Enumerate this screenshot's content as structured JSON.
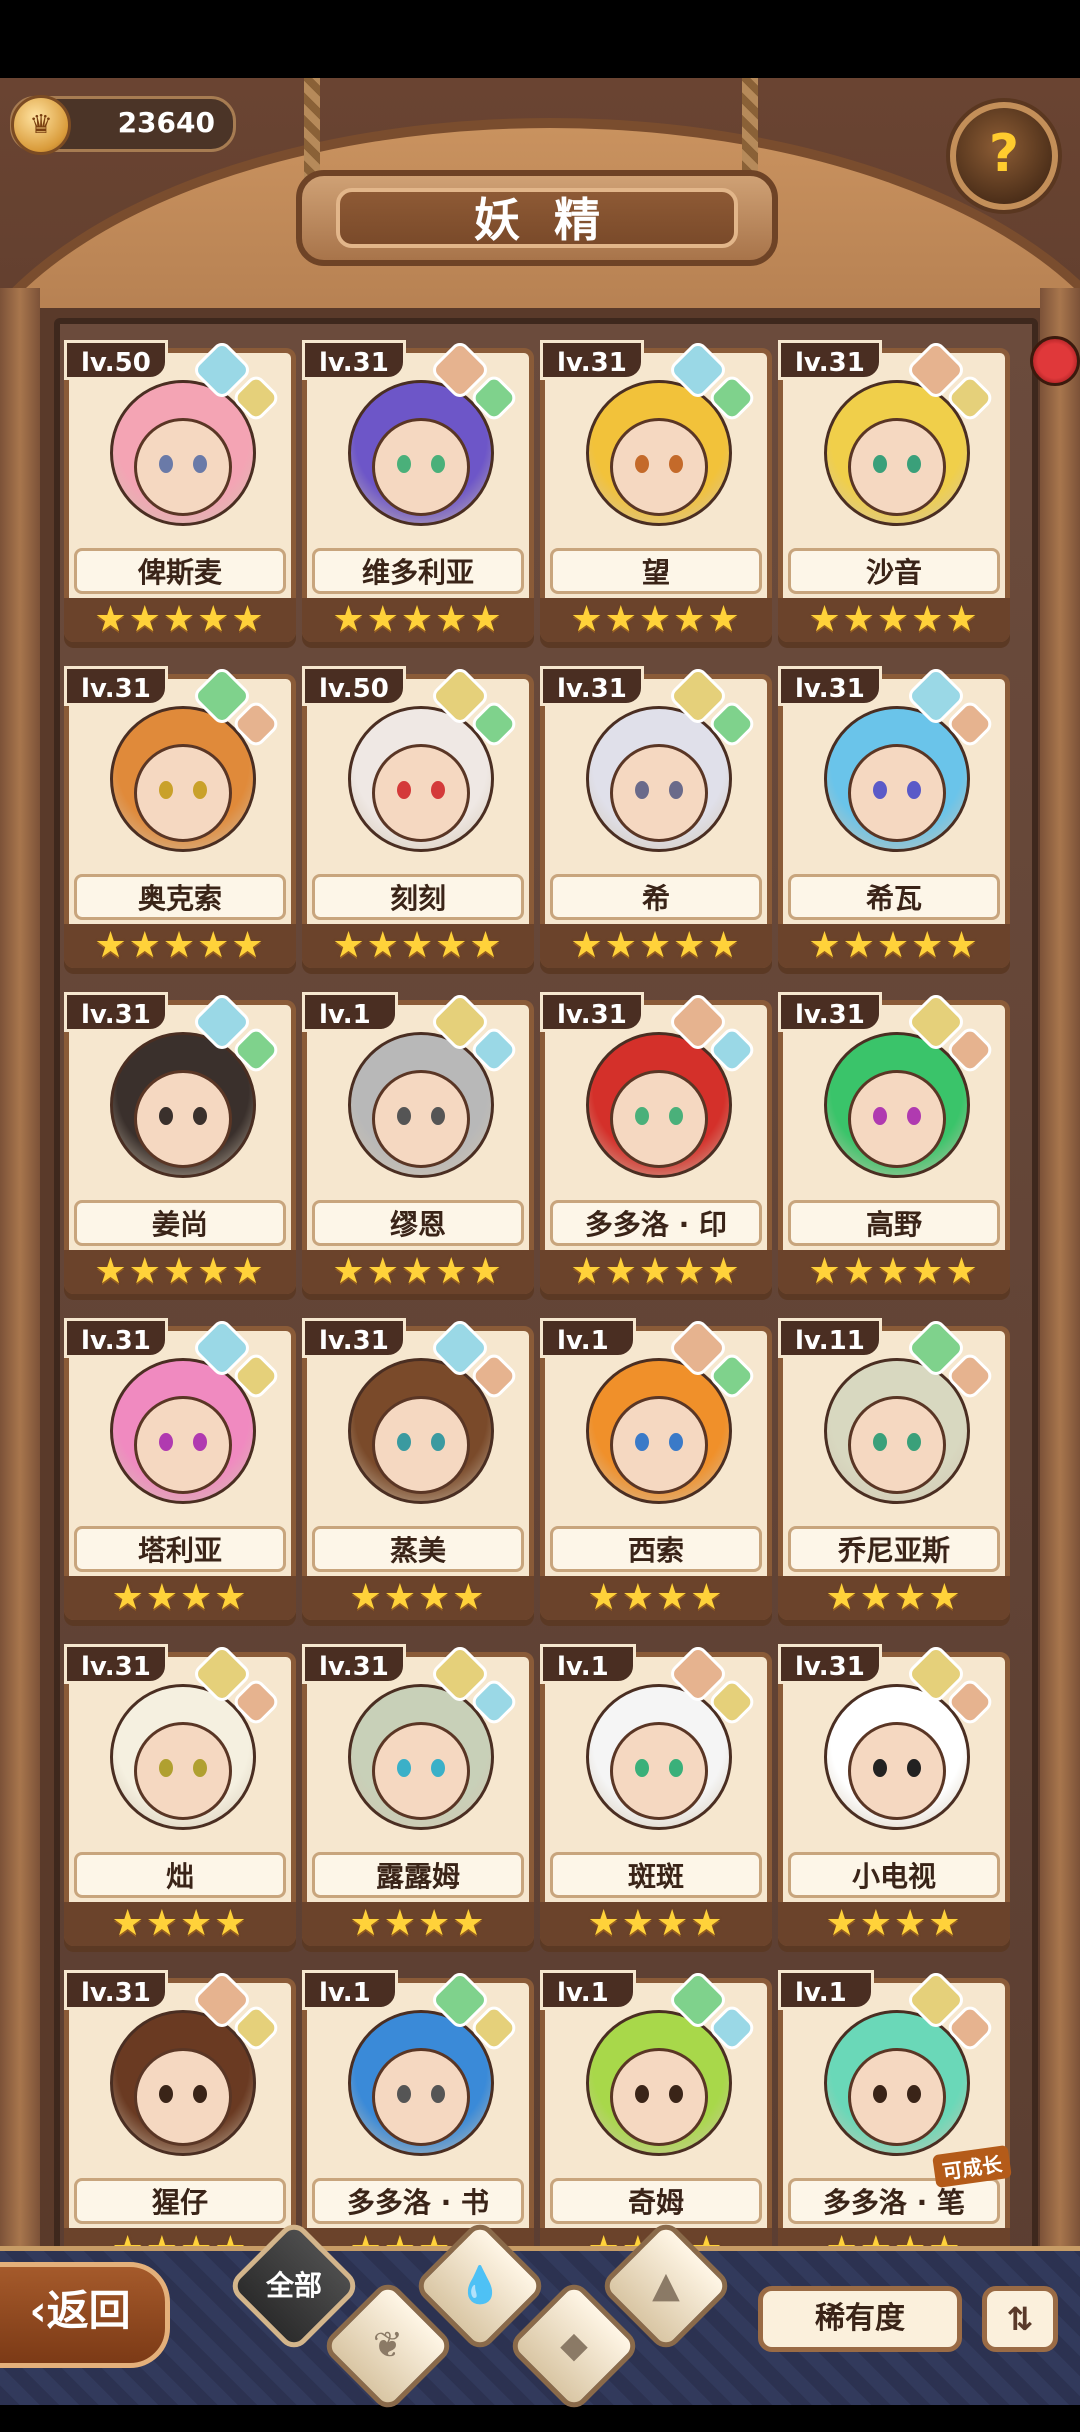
{
  "header": {
    "coins": "23640",
    "coin_icon": "crown-coin-icon",
    "title": "妖精",
    "help_icon": "question-mark-icon"
  },
  "star_glyph": "★",
  "fairies": [
    {
      "name": "俾斯麦",
      "level": "lv.50",
      "stars": 5,
      "hair": "#f4a4b4",
      "eye": "#6a7aa8",
      "gems": [
        "#9ad8e6",
        "#e5d07a"
      ]
    },
    {
      "name": "维多利亚",
      "level": "lv.31",
      "stars": 5,
      "hair": "#6d56c8",
      "eye": "#4ab07a",
      "gems": [
        "#e6b38f",
        "#7fd28c"
      ]
    },
    {
      "name": "望",
      "level": "lv.31",
      "stars": 5,
      "hair": "#f2c23a",
      "eye": "#c46a2a",
      "gems": [
        "#9ad8e6",
        "#7fd28c"
      ]
    },
    {
      "name": "沙音",
      "level": "lv.31",
      "stars": 5,
      "hair": "#f0cf4a",
      "eye": "#3aa07a",
      "gems": [
        "#e6b38f",
        "#e5d07a"
      ]
    },
    {
      "name": "奥克索",
      "level": "lv.31",
      "stars": 5,
      "hair": "#e08a3a",
      "eye": "#c9a12a",
      "gems": [
        "#7fd28c",
        "#e6b38f"
      ]
    },
    {
      "name": "刻刻",
      "level": "lv.50",
      "stars": 5,
      "hair": "#efe8e4",
      "eye": "#d43a3a",
      "gems": [
        "#e5d07a",
        "#7fd28c"
      ]
    },
    {
      "name": "希",
      "level": "lv.31",
      "stars": 5,
      "hair": "#e0e0ea",
      "eye": "#6a6a8a",
      "gems": [
        "#e5d07a",
        "#7fd28c"
      ]
    },
    {
      "name": "希瓦",
      "level": "lv.31",
      "stars": 5,
      "hair": "#6ac4ea",
      "eye": "#5a5ac8",
      "gems": [
        "#9ad8e6",
        "#e6b38f"
      ]
    },
    {
      "name": "姜尚",
      "level": "lv.31",
      "stars": 5,
      "hair": "#3a302c",
      "eye": "#3a302c",
      "gems": [
        "#9ad8e6",
        "#7fd28c"
      ]
    },
    {
      "name": "缪恩",
      "level": "lv.1",
      "stars": 5,
      "hair": "#b8b8b8",
      "eye": "#555555",
      "gems": [
        "#e5d07a",
        "#9ad8e6"
      ]
    },
    {
      "name": "多多洛 · 印",
      "level": "lv.31",
      "stars": 5,
      "hair": "#d4302a",
      "eye": "#4ab07a",
      "gems": [
        "#e6b38f",
        "#9ad8e6"
      ]
    },
    {
      "name": "高野",
      "level": "lv.31",
      "stars": 5,
      "hair": "#3ac46a",
      "eye": "#b03ab0",
      "gems": [
        "#e5d07a",
        "#e6b38f"
      ]
    },
    {
      "name": "塔利亚",
      "level": "lv.31",
      "stars": 4,
      "hair": "#f08ac0",
      "eye": "#b03ab0",
      "gems": [
        "#9ad8e6",
        "#e5d07a"
      ]
    },
    {
      "name": "蒸美",
      "level": "lv.31",
      "stars": 4,
      "hair": "#7a4a2a",
      "eye": "#3a9aa0",
      "gems": [
        "#9ad8e6",
        "#e6b38f"
      ]
    },
    {
      "name": "西索",
      "level": "lv.1",
      "stars": 4,
      "hair": "#f0902a",
      "eye": "#3a7ac8",
      "gems": [
        "#e6b38f",
        "#7fd28c"
      ]
    },
    {
      "name": "乔尼亚斯",
      "level": "lv.11",
      "stars": 4,
      "hair": "#d8d8c0",
      "eye": "#3aa07a",
      "gems": [
        "#7fd28c",
        "#e6b38f"
      ]
    },
    {
      "name": "炪",
      "level": "lv.31",
      "stars": 4,
      "hair": "#f5f0e0",
      "eye": "#b0a030",
      "gems": [
        "#e5d07a",
        "#e6b38f"
      ]
    },
    {
      "name": "露露姆",
      "level": "lv.31",
      "stars": 4,
      "hair": "#c8d0b8",
      "eye": "#3ab0c8",
      "gems": [
        "#e5d07a",
        "#9ad8e6"
      ]
    },
    {
      "name": "斑斑",
      "level": "lv.1",
      "stars": 4,
      "hair": "#f5f5f5",
      "eye": "#3ab07a",
      "gems": [
        "#e6b38f",
        "#e5d07a"
      ]
    },
    {
      "name": "小电视",
      "level": "lv.31",
      "stars": 4,
      "hair": "#ffffff",
      "eye": "#222222",
      "gems": [
        "#e5d07a",
        "#e6b38f"
      ]
    },
    {
      "name": "猩仔",
      "level": "lv.31",
      "stars": 4,
      "hair": "#6a3a22",
      "eye": "#3a2418",
      "gems": [
        "#e6b38f",
        "#e5d07a"
      ]
    },
    {
      "name": "多多洛 · 书",
      "level": "lv.1",
      "stars": 4,
      "hair": "#3a8ad8",
      "eye": "#555555",
      "gems": [
        "#7fd28c",
        "#e5d07a"
      ]
    },
    {
      "name": "奇姆",
      "level": "lv.1",
      "stars": 4,
      "hair": "#a8d84a",
      "eye": "#3a2418",
      "gems": [
        "#7fd28c",
        "#9ad8e6"
      ]
    },
    {
      "name": "多多洛 · 笔",
      "level": "lv.1",
      "stars": 4,
      "hair": "#6ad8b8",
      "eye": "#3a2418",
      "gems": [
        "#e5d07a",
        "#e6b38f"
      ],
      "badge": "可成长"
    }
  ],
  "bottom": {
    "back_label": "返回",
    "back_icon": "chevron-left-icon",
    "filter_all": "全部",
    "filter_icons": [
      "water-drop-icon",
      "mountain-icon",
      "sprout-icon",
      "rock-icon"
    ],
    "rarity_label": "稀有度",
    "sort_icon": "sort-order-icon"
  }
}
